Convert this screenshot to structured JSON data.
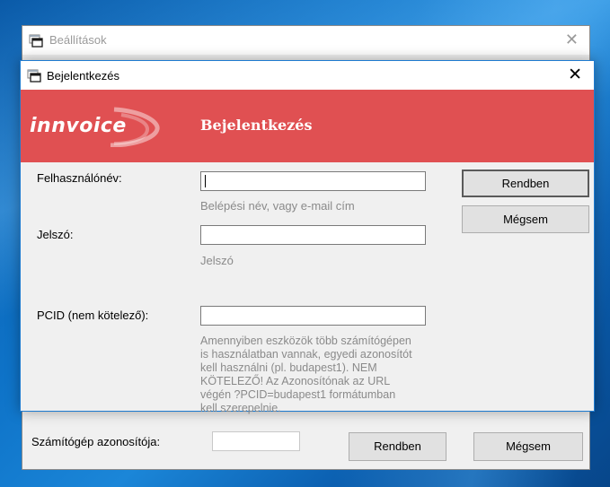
{
  "background_window": {
    "title": "Beállítások",
    "close_glyph": "✕",
    "computer_id_label": "Számítógép azonosítója:",
    "ok_label": "Rendben",
    "cancel_label": "Mégsem"
  },
  "dialog": {
    "title": "Bejelentkezés",
    "close_glyph": "✕",
    "banner": {
      "logo_text": "innvoice",
      "heading": "Bejelentkezés",
      "color": "#e05052"
    },
    "username": {
      "label": "Felhasználónév:",
      "value": "",
      "hint": "Belépési név, vagy e-mail cím"
    },
    "password": {
      "label": "Jelszó:",
      "value": "",
      "hint": "Jelszó"
    },
    "pcid": {
      "label": "PCID (nem kötelező):",
      "value": "",
      "hint_lines": [
        "Amennyiben eszközök több számítógépen",
        "is használatban vannak, egyedi azonosítót",
        "kell használni (pl. budapest1). NEM",
        "KÖTELEZŐ! Az Azonosítónak az URL",
        "végén ?PCID=budapest1 formátumban",
        "kell szerepelnie."
      ]
    },
    "ok_label": "Rendben",
    "cancel_label": "Mégsem"
  },
  "icons": {
    "app_icon": "window-app-icon",
    "close": "close-icon"
  }
}
